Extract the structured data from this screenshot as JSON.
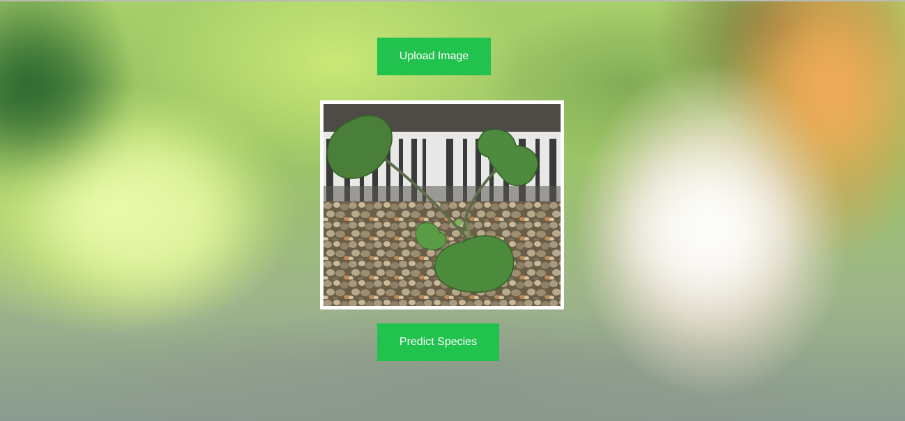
{
  "actions": {
    "upload_label": "Upload Image",
    "predict_label": "Predict Species"
  },
  "preview": {
    "content": "seedling-photo"
  },
  "colors": {
    "button": "#22c24f",
    "button_text": "#ffffff",
    "frame": "#ffffff"
  }
}
